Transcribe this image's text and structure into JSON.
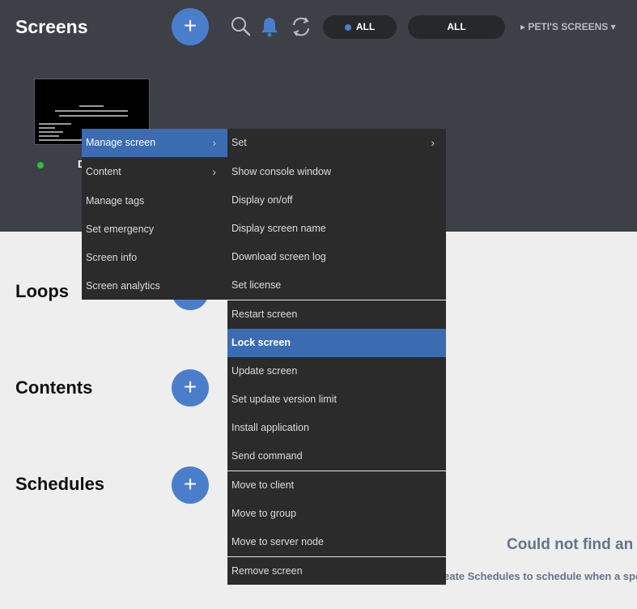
{
  "header": {
    "title": "Screens",
    "add_label": "+",
    "filter_status_label": "ALL",
    "filter_second_label": "ALL",
    "workspace_label": "PETI'S SCREENS",
    "workspace_caret": "▾",
    "workspace_arrow": "▸"
  },
  "screen": {
    "name_fragment": "D",
    "status_color": "#2fbf3b"
  },
  "sections": {
    "loops": "Loops",
    "contents": "Contents",
    "schedules": "Schedules",
    "add_label": "+"
  },
  "empty_state": {
    "title": "Could not find an",
    "subtitle": "eate Schedules to schedule when a spe"
  },
  "context_menu": {
    "primary": [
      {
        "label": "Manage screen",
        "has_submenu": true,
        "active": true
      },
      {
        "label": "Content",
        "has_submenu": true
      },
      {
        "label": "Manage tags"
      },
      {
        "label": "Set emergency"
      },
      {
        "label": "Screen info"
      },
      {
        "label": "Screen analytics"
      }
    ],
    "submenu": [
      {
        "label": "Set",
        "has_submenu": true
      },
      {
        "label": "Show console window"
      },
      {
        "label": "Display on/off"
      },
      {
        "label": "Display screen name"
      },
      {
        "label": "Download screen log"
      },
      {
        "label": "Set license"
      },
      {
        "label": "Restart screen"
      },
      {
        "label": "Lock screen",
        "highlighted": true
      },
      {
        "label": "Update screen"
      },
      {
        "label": "Set update version limit"
      },
      {
        "label": "Install application"
      },
      {
        "label": "Send command"
      },
      {
        "label": "Move to client"
      },
      {
        "label": "Move to group"
      },
      {
        "label": "Move to server node"
      },
      {
        "label": "Remove screen"
      }
    ],
    "chevron": "›"
  },
  "colors": {
    "top_bar": "#3d4047",
    "accent": "#4a7ecb",
    "menu_bg": "#2b2b2b",
    "menu_highlight": "#3b6bb0",
    "page_bg": "#eeeeee"
  },
  "icons": [
    "search-icon",
    "bell-icon",
    "refresh-icon",
    "chevron-right-icon"
  ]
}
